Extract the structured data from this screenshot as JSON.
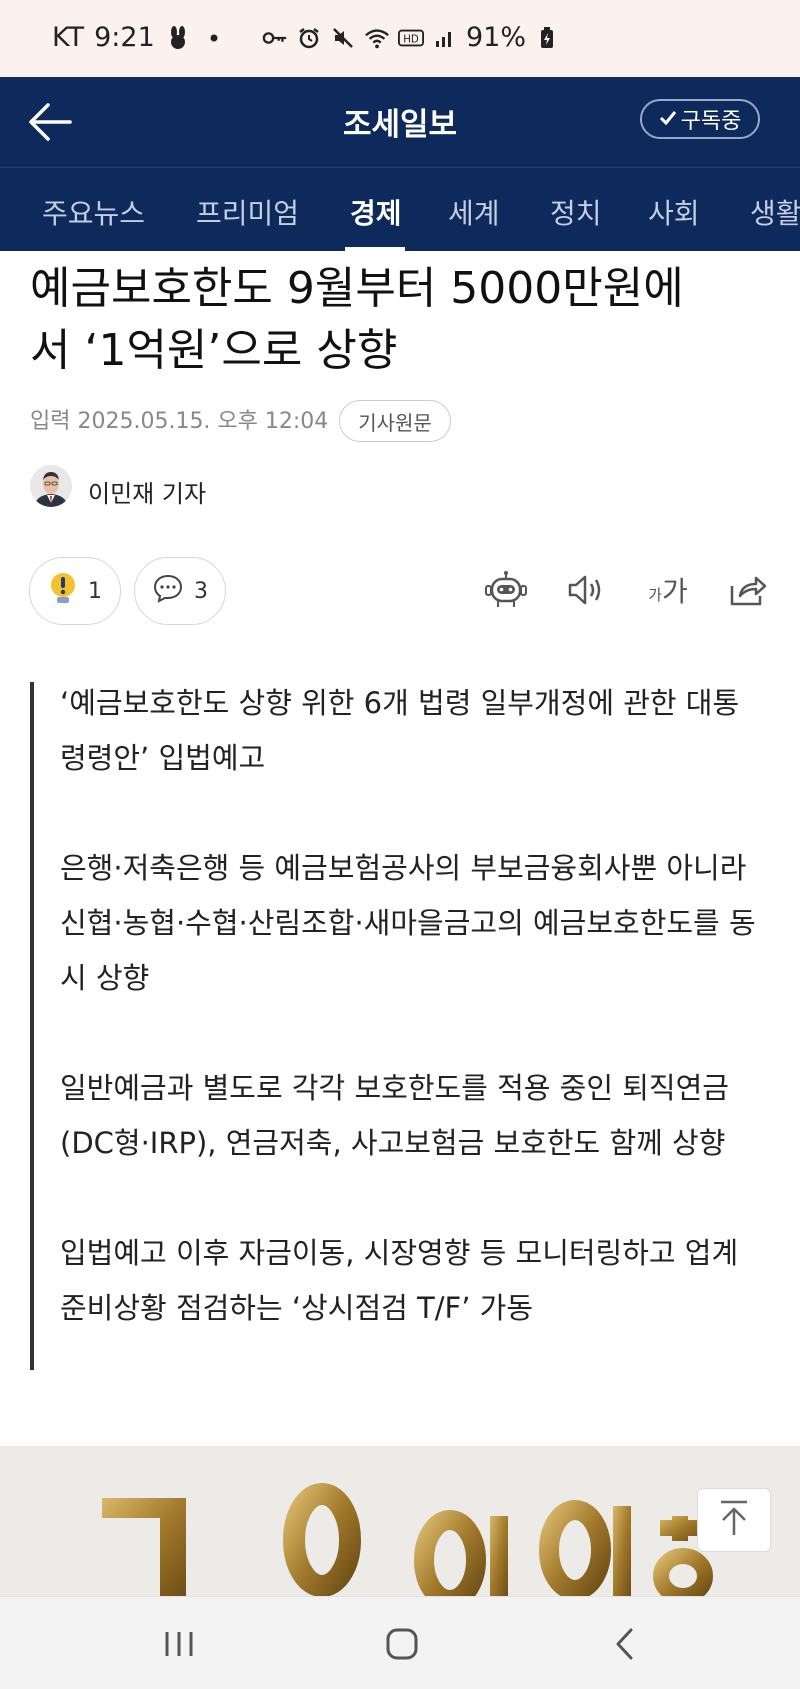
{
  "status_bar": {
    "carrier": "KT",
    "time": "9:21",
    "battery": "91%",
    "icons": [
      "bunny-icon",
      "dot-icon",
      "key-icon",
      "alarm-icon",
      "mute-icon",
      "wifi-icon",
      "hd-icon",
      "signal-icon",
      "battery-icon"
    ]
  },
  "header": {
    "title": "조세일보",
    "subscribe_label": "구독중"
  },
  "tabs": [
    {
      "label": "주요뉴스"
    },
    {
      "label": "프리미엄"
    },
    {
      "label": "경제",
      "active": true
    },
    {
      "label": "세계"
    },
    {
      "label": "정치"
    },
    {
      "label": "사회"
    },
    {
      "label": "생활"
    }
  ],
  "article": {
    "title_line1": "예금보호한도 9월부터 5000만원에",
    "title_line2": "서 ‘1억원’으로 상향",
    "published": "입력 2025.05.15. 오후 12:04",
    "original_link_label": "기사원문",
    "reporter": "이민재 기자",
    "reactions": {
      "like_count": "1",
      "comment_count": "3"
    },
    "summary": [
      "‘예금보호한도 상향 위한 6개 법령 일부개정에 관한 대통령령안’ 입법예고",
      "은행·저축은행 등 예금보험공사의 부보금융회사뿐 아니라 신협·농협·수협·산림조합·새마을금고의 예금보호한도를 동시 상향",
      "일반예금과 별도로 각각 보호한도를 적용 중인 퇴직연금(DC형·IRP), 연금저축, 사고보험금 보호한도 함께 상향",
      "입법예고 이후 자금이동, 시장영향 등 모니터링하고 업계 준비상황 점검하는 ‘상시점검 T/F’ 가동"
    ]
  },
  "toolbar": {
    "font_size_label_small": "가",
    "font_size_label_large": "가"
  },
  "colors": {
    "header_bg": "#0e2a5c",
    "status_bg": "#fbf1ee",
    "accent_bulb": "#f2c230"
  }
}
